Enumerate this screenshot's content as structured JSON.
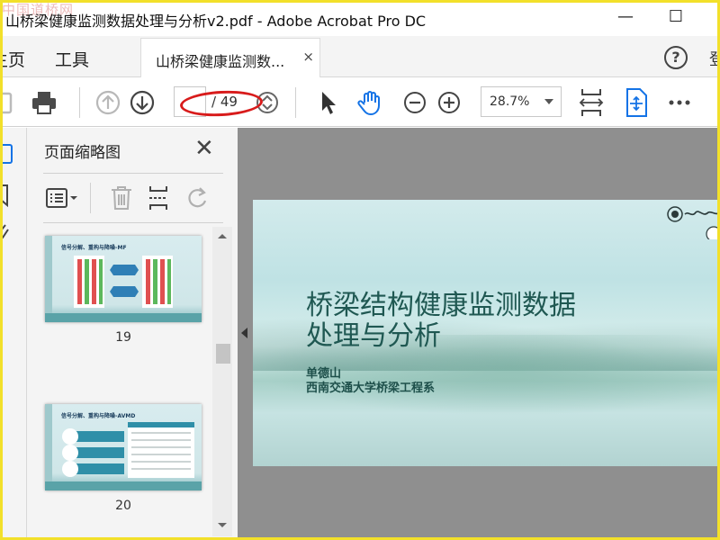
{
  "window": {
    "title": "山桥梁健康监测数据处理与分析v2.pdf - Adobe Acrobat Pro DC",
    "watermark": "中国道桥网",
    "minimize": "—",
    "maximize": "☐"
  },
  "tabs": {
    "home": "主页",
    "tools": "工具",
    "doc_tab_label": "山桥梁健康监测数...",
    "close_glyph": "×",
    "help_glyph": "?",
    "sign_in": "登"
  },
  "toolbar": {
    "current_page": "",
    "page_total": "/ 49",
    "zoom": "28.7%"
  },
  "thumbnails": {
    "title": "页面缩略图",
    "close_glyph": "✕",
    "pages": [
      {
        "number": "19",
        "heading": "信号分解、重构与降噪-MF"
      },
      {
        "number": "20",
        "heading": "信号分解、重构与降噪-AVMD"
      }
    ]
  },
  "slide": {
    "title_line1": "桥梁结构健康监测数据",
    "title_line2": "处理与分析",
    "author": "单德山",
    "affiliation": "西南交通大学桥梁工程系"
  },
  "colors": {
    "frame": "#f2e02a",
    "annotation": "#d81b1b",
    "acrobat_blue": "#1473e6",
    "slide_text": "#1f5852"
  }
}
